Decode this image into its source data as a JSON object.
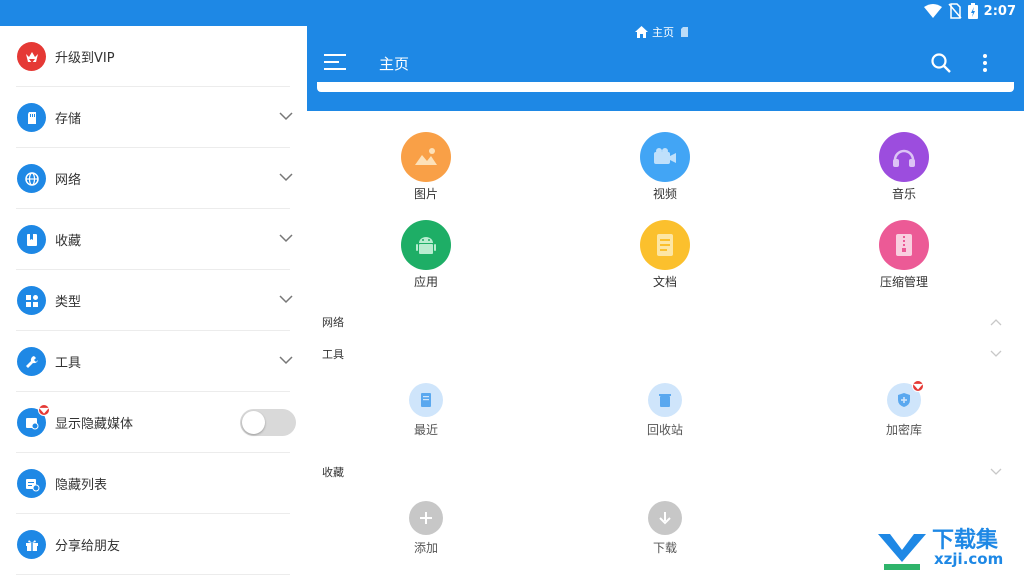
{
  "status_bar": {
    "time": "2:07"
  },
  "breadcrumb": {
    "label": "主页"
  },
  "appbar": {
    "title": "主页"
  },
  "drawer": {
    "items": [
      {
        "label": "升级到VIP"
      },
      {
        "label": "存储"
      },
      {
        "label": "网络"
      },
      {
        "label": "收藏"
      },
      {
        "label": "类型"
      },
      {
        "label": "工具"
      },
      {
        "label": "显示隐藏媒体"
      },
      {
        "label": "隐藏列表"
      },
      {
        "label": "分享给朋友"
      }
    ]
  },
  "categories": [
    {
      "label": "图片",
      "color": "#f9a047"
    },
    {
      "label": "视频",
      "color": "#42a5f5"
    },
    {
      "label": "音乐",
      "color": "#9c4dde"
    },
    {
      "label": "应用",
      "color": "#1eae66"
    },
    {
      "label": "文档",
      "color": "#fbc02d"
    },
    {
      "label": "压缩管理",
      "color": "#ec5a96"
    }
  ],
  "sections": {
    "network": "网络",
    "tools": "工具",
    "favorites": "收藏"
  },
  "tools": [
    {
      "label": "最近"
    },
    {
      "label": "回收站"
    },
    {
      "label": "加密库"
    }
  ],
  "favorites": [
    {
      "label": "添加"
    },
    {
      "label": "下载"
    }
  ],
  "watermark": {
    "title": "下载集",
    "sub": "xzji.com"
  },
  "colors": {
    "primary": "#1e88e5",
    "vip_red": "#e53935"
  }
}
